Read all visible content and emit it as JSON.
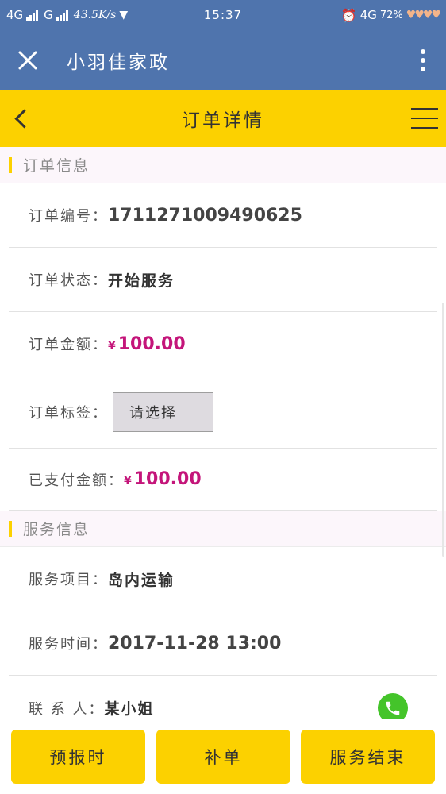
{
  "status_bar": {
    "network_1": "4G",
    "network_2": "G",
    "speed": "43.5K/s",
    "time": "15:37",
    "network_3": "4G",
    "battery": "72%",
    "hearts": "♥♥♥♥"
  },
  "app_bar": {
    "title": "小羽佳家政",
    "close_icon": "close-icon",
    "more_icon": "more-vertical-icon"
  },
  "page_header": {
    "title": "订单详情",
    "back_icon": "chevron-left-icon",
    "menu_icon": "menu-icon",
    "accent_color": "#fcd100"
  },
  "order_section": {
    "title": "订单信息",
    "order_no_label": "订单编号：",
    "order_no": "1711271009490625",
    "status_label": "订单状态：",
    "status": "开始服务",
    "amount_label": "订单金额：",
    "amount_currency": "¥",
    "amount": "100.00",
    "tag_label": "订单标签：",
    "tag_placeholder": "请选择",
    "paid_label": "已支付金额：",
    "paid_currency": "¥",
    "paid": "100.00",
    "money_color": "#c4157a"
  },
  "service_section": {
    "title": "服务信息",
    "item_label": "服务项目：",
    "item": "岛内运输",
    "time_label": "服务时间：",
    "time": "2017-11-28 13:00",
    "contact_label": "联 系 人：",
    "contact": "某小姐",
    "phone_icon": "phone-icon"
  },
  "bottom_bar": {
    "report_time": "预报时",
    "supplement": "补单",
    "finish": "服务结束"
  }
}
